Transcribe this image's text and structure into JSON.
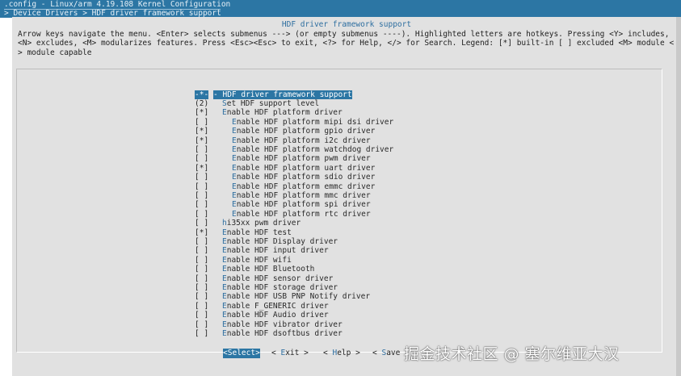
{
  "window": {
    "title": ".config - Linux/arm 4.19.108 Kernel Configuration",
    "breadcrumb": "> Device Drivers > HDF driver framework support"
  },
  "dialog": {
    "title": "HDF driver framework support",
    "help": "Arrow keys navigate the menu.  <Enter> selects submenus ---> (or empty submenus ----).  Highlighted letters are hotkeys.  Pressing <Y> includes, <N> excludes, <M> modularizes features.  Press <Esc><Esc> to exit, <?> for Help, </> for Search.  Legend: [*] built-in  [ ] excluded  <M> module  < > module capable"
  },
  "items": [
    {
      "mark": "-*-",
      "hot": "H",
      "rest": "DF driver framework support",
      "indent": 0,
      "selected": true
    },
    {
      "mark": "(2)",
      "hot": "S",
      "rest": "et HDF support level",
      "indent": 0
    },
    {
      "mark": "[*]",
      "hot": "E",
      "rest": "nable HDF platform driver",
      "indent": 0
    },
    {
      "mark": "[ ]",
      "hot": "E",
      "rest": "nable HDF platform mipi dsi driver",
      "indent": 1
    },
    {
      "mark": "[*]",
      "hot": "E",
      "rest": "nable HDF platform gpio driver",
      "indent": 1
    },
    {
      "mark": "[*]",
      "hot": "E",
      "rest": "nable HDF platform i2c driver",
      "indent": 1
    },
    {
      "mark": "[ ]",
      "hot": "E",
      "rest": "nable HDF platform watchdog driver",
      "indent": 1
    },
    {
      "mark": "[ ]",
      "hot": "E",
      "rest": "nable HDF platform pwm driver",
      "indent": 1
    },
    {
      "mark": "[*]",
      "hot": "E",
      "rest": "nable HDF platform uart driver",
      "indent": 1
    },
    {
      "mark": "[ ]",
      "hot": "E",
      "rest": "nable HDF platform sdio driver",
      "indent": 1
    },
    {
      "mark": "[ ]",
      "hot": "E",
      "rest": "nable HDF platform emmc driver",
      "indent": 1
    },
    {
      "mark": "[ ]",
      "hot": "E",
      "rest": "nable HDF platform mmc driver",
      "indent": 1
    },
    {
      "mark": "[ ]",
      "hot": "E",
      "rest": "nable HDF platform spi driver",
      "indent": 1
    },
    {
      "mark": "[ ]",
      "hot": "E",
      "rest": "nable HDF platform rtc driver",
      "indent": 1
    },
    {
      "mark": "[ ]",
      "hot": "h",
      "rest": "i35xx pwm driver",
      "indent": 0
    },
    {
      "mark": "[*]",
      "hot": "E",
      "rest": "nable HDF test",
      "indent": 0
    },
    {
      "mark": "[ ]",
      "hot": "E",
      "rest": "nable HDF Display driver",
      "indent": 0
    },
    {
      "mark": "[ ]",
      "hot": "E",
      "rest": "nable HDF input driver",
      "indent": 0
    },
    {
      "mark": "[ ]",
      "hot": "E",
      "rest": "nable HDF wifi",
      "indent": 0
    },
    {
      "mark": "[ ]",
      "hot": "E",
      "rest": "nable HDF Bluetooth",
      "indent": 0
    },
    {
      "mark": "[ ]",
      "hot": "E",
      "rest": "nable HDF sensor driver",
      "indent": 0
    },
    {
      "mark": "[ ]",
      "hot": "E",
      "rest": "nable HDF storage driver",
      "indent": 0
    },
    {
      "mark": "[ ]",
      "hot": "E",
      "rest": "nable HDF USB PNP Notify driver",
      "indent": 0
    },
    {
      "mark": "[ ]",
      "hot": "E",
      "rest": "nable F_GENERIC driver",
      "indent": 0
    },
    {
      "mark": "[ ]",
      "hot": "E",
      "rest": "nable HDF Audio driver",
      "indent": 0
    },
    {
      "mark": "[ ]",
      "hot": "E",
      "rest": "nable HDF vibrator driver",
      "indent": 0
    },
    {
      "mark": "[ ]",
      "hot": "E",
      "rest": "nable HDF dsoftbus driver",
      "indent": 0
    }
  ],
  "buttons": [
    {
      "pre": "<",
      "hot": "S",
      "rest": "elect>",
      "active": true
    },
    {
      "pre": "< ",
      "hot": "E",
      "rest": "xit >",
      "active": false
    },
    {
      "pre": "< ",
      "hot": "H",
      "rest": "elp >",
      "active": false
    },
    {
      "pre": "< ",
      "hot": "S",
      "rest": "ave",
      "active": false
    }
  ],
  "watermark": "掘金技术社区 @ 塞尔维亚大汉",
  "colors": {
    "accent": "#2c76a4",
    "hotkey": "#2f6fa0",
    "dialog": "#e1e1e1"
  }
}
